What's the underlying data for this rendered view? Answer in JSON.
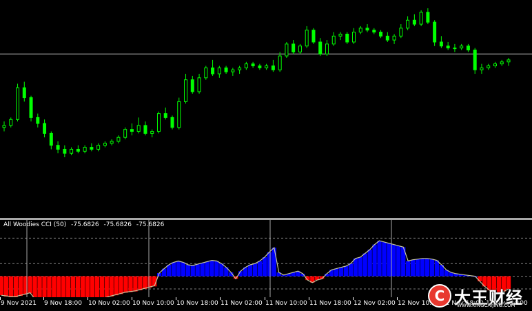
{
  "indicator": {
    "name": "All Woodies CCI (50)",
    "values": [
      "-75.6826",
      "-75.6826",
      "-75.6826"
    ]
  },
  "colors": {
    "background": "#000000",
    "bull_candle": "#00ff00",
    "bear_candle": "#00ff00",
    "grid": "#c0c0c0",
    "separator": "#a8a8a8",
    "hist_positive": "#0000ff",
    "hist_negative": "#ff0000",
    "cci_line": "#c8c8a0",
    "watermark_red": "#e8382f"
  },
  "x_axis": {
    "labels": [
      "9 Nov 2021",
      "9 Nov 18:00",
      "10 Nov 02:00",
      "10 Nov 10:00",
      "10 Nov 18:00",
      "11 Nov 02:00",
      "11 Nov 10:00",
      "11 Nov 18:00",
      "12 Nov 02:00",
      "12 Nov 10:00",
      "12 Nov 18:00",
      "12 Nov 04:00"
    ]
  },
  "watermark": {
    "logo": "C",
    "text": "大王财经",
    "url": "WWW.KINGCAIJING.COM"
  },
  "chart_data": [
    {
      "type": "candlestick",
      "title": "",
      "xlabel": "",
      "ylabel": "",
      "ylim": [
        0,
        100
      ],
      "horizontal_line": 77,
      "ohlc": [
        [
          40,
          43,
          38,
          41
        ],
        [
          41,
          45,
          40,
          44
        ],
        [
          44,
          62,
          43,
          60
        ],
        [
          60,
          63,
          53,
          55
        ],
        [
          55,
          56,
          43,
          45
        ],
        [
          45,
          47,
          40,
          42
        ],
        [
          42,
          44,
          35,
          37
        ],
        [
          37,
          38,
          29,
          31
        ],
        [
          31,
          33,
          27,
          29
        ],
        [
          29,
          31,
          25,
          27
        ],
        [
          27,
          30,
          26,
          29
        ],
        [
          29,
          31,
          27,
          28
        ],
        [
          28,
          31,
          27,
          30
        ],
        [
          30,
          32,
          28,
          29
        ],
        [
          29,
          32,
          28,
          31
        ],
        [
          31,
          33,
          30,
          32
        ],
        [
          32,
          34,
          31,
          33
        ],
        [
          33,
          36,
          32,
          35
        ],
        [
          35,
          40,
          34,
          39
        ],
        [
          39,
          42,
          36,
          38
        ],
        [
          38,
          45,
          37,
          41
        ],
        [
          41,
          43,
          36,
          37
        ],
        [
          37,
          39,
          35,
          38
        ],
        [
          38,
          48,
          37,
          47
        ],
        [
          47,
          50,
          44,
          45
        ],
        [
          45,
          46,
          39,
          40
        ],
        [
          40,
          55,
          39,
          53
        ],
        [
          53,
          67,
          52,
          64
        ],
        [
          64,
          66,
          57,
          58
        ],
        [
          58,
          67,
          57,
          65
        ],
        [
          65,
          71,
          64,
          70
        ],
        [
          70,
          74,
          66,
          67
        ],
        [
          67,
          71,
          65,
          70
        ],
        [
          70,
          71,
          67,
          68
        ],
        [
          68,
          70,
          66,
          69
        ],
        [
          69,
          71,
          67,
          70
        ],
        [
          70,
          73,
          69,
          72
        ],
        [
          72,
          73,
          70,
          71
        ],
        [
          71,
          72,
          69,
          70
        ],
        [
          70,
          72,
          69,
          71
        ],
        [
          71,
          74,
          68,
          69
        ],
        [
          69,
          78,
          68,
          76
        ],
        [
          76,
          83,
          75,
          82
        ],
        [
          82,
          84,
          77,
          78
        ],
        [
          78,
          82,
          77,
          81
        ],
        [
          81,
          91,
          80,
          89
        ],
        [
          89,
          90,
          82,
          83
        ],
        [
          83,
          85,
          76,
          77
        ],
        [
          77,
          84,
          76,
          82
        ],
        [
          82,
          88,
          81,
          86
        ],
        [
          86,
          88,
          84,
          87
        ],
        [
          87,
          88,
          82,
          83
        ],
        [
          83,
          90,
          82,
          88
        ],
        [
          88,
          91,
          87,
          90
        ],
        [
          90,
          92,
          88,
          89
        ],
        [
          89,
          90,
          87,
          88
        ],
        [
          88,
          89,
          85,
          86
        ],
        [
          86,
          88,
          83,
          84
        ],
        [
          84,
          87,
          82,
          86
        ],
        [
          86,
          92,
          85,
          90
        ],
        [
          90,
          96,
          89,
          94
        ],
        [
          94,
          97,
          91,
          92
        ],
        [
          92,
          99,
          91,
          98
        ],
        [
          98,
          100,
          92,
          93
        ],
        [
          93,
          94,
          81,
          83
        ],
        [
          83,
          86,
          80,
          81
        ],
        [
          81,
          83,
          79,
          80
        ],
        [
          80,
          82,
          78,
          80
        ],
        [
          80,
          82,
          79,
          81
        ],
        [
          81,
          82,
          78,
          79
        ],
        [
          79,
          80,
          67,
          69
        ],
        [
          69,
          72,
          67,
          70
        ],
        [
          70,
          72,
          69,
          71
        ],
        [
          71,
          73,
          70,
          72
        ],
        [
          72,
          74,
          71,
          73
        ],
        [
          73,
          75,
          71,
          74
        ]
      ]
    },
    {
      "type": "bar",
      "title": "",
      "xlabel": "",
      "ylabel": "",
      "ylim": [
        -20,
        80
      ],
      "histogram": [
        -30,
        -32,
        -34,
        -33,
        -31,
        -29,
        -27,
        -40,
        -44,
        -46,
        -47,
        -47,
        -46,
        -45,
        -44,
        -43,
        -42,
        -40,
        -39,
        -38,
        -37,
        -36,
        -34,
        -32,
        -30,
        -28,
        -26,
        -25,
        -24,
        -22,
        -20,
        -18,
        -16,
        5,
        12,
        18,
        22,
        24,
        22,
        18,
        17,
        19,
        21,
        23,
        25,
        24,
        20,
        14,
        6,
        -4,
        8,
        14,
        18,
        20,
        24,
        30,
        38,
        45,
        6,
        2,
        4,
        6,
        8,
        4,
        -6,
        -10,
        -6,
        -4,
        4,
        10,
        12,
        14,
        16,
        20,
        28,
        30,
        36,
        42,
        50,
        56,
        54,
        52,
        50,
        48,
        46,
        24,
        26,
        27,
        28,
        28,
        27,
        25,
        18,
        10,
        6,
        4,
        3,
        2,
        1,
        0,
        -8,
        -16,
        -22,
        -28,
        -26,
        -24,
        -20
      ],
      "cci": [
        -30,
        -31,
        -32,
        -32,
        -30,
        -28,
        -26,
        -36,
        -40,
        -44,
        -46,
        -46,
        -45,
        -44,
        -43,
        -42,
        -41,
        -39,
        -38,
        -37,
        -36,
        -35,
        -33,
        -31,
        -29,
        -27,
        -25,
        -24,
        -23,
        -21,
        -19,
        -17,
        -15,
        5,
        12,
        18,
        22,
        24,
        22,
        18,
        17,
        19,
        21,
        23,
        25,
        24,
        20,
        14,
        6,
        -4,
        8,
        14,
        18,
        20,
        24,
        30,
        38,
        45,
        6,
        2,
        4,
        6,
        8,
        4,
        -6,
        -10,
        -6,
        -4,
        4,
        10,
        12,
        14,
        16,
        20,
        28,
        30,
        36,
        42,
        50,
        56,
        54,
        52,
        50,
        48,
        46,
        24,
        26,
        27,
        28,
        28,
        27,
        25,
        18,
        10,
        6,
        4,
        3,
        2,
        1,
        0,
        -8,
        -16,
        -22,
        -28,
        -26,
        -24,
        -20
      ]
    }
  ]
}
